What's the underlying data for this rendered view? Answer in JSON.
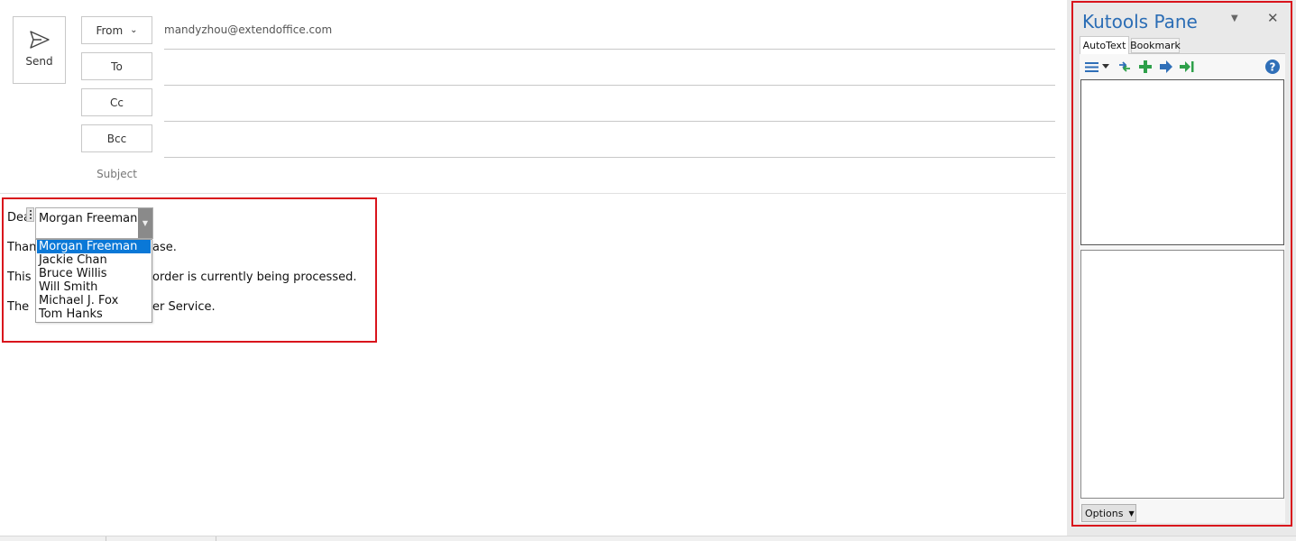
{
  "compose": {
    "send_label": "Send",
    "from_label": "From",
    "from_address": "mandyzhou@extendoffice.com",
    "to_label": "To",
    "cc_label": "Cc",
    "bcc_label": "Bcc",
    "subject_label": "Subject"
  },
  "body": {
    "line1_prefix": "Dea",
    "line2": "Than",
    "line2_suffix": "ase.",
    "line3": "This",
    "line3_suffix": "order is currently being processed.",
    "line4": "The",
    "line4_suffix": "er Service.",
    "combo_value": "Morgan Freeman,",
    "dropdown_options": [
      "Morgan Freeman",
      "Jackie Chan",
      "Bruce Willis",
      "Will Smith",
      "Michael J. Fox",
      "Tom Hanks"
    ],
    "selected_option": "Morgan Freeman"
  },
  "kutools_pane": {
    "title": "Kutools Pane",
    "tabs": [
      "AutoText",
      "Bookmark"
    ],
    "active_tab": "AutoText",
    "toolbar_icons": [
      "list-view-icon",
      "dropdown-arrow-icon",
      "refresh-icon",
      "add-icon",
      "move-icon",
      "insert-icon",
      "help-icon"
    ],
    "options_label": "Options"
  },
  "colors": {
    "highlight_border": "#d9141c",
    "pane_title": "#2b6db5",
    "selection": "#0a78d7",
    "tool_green": "#2ea04a",
    "tool_blue": "#2f6fb8"
  }
}
